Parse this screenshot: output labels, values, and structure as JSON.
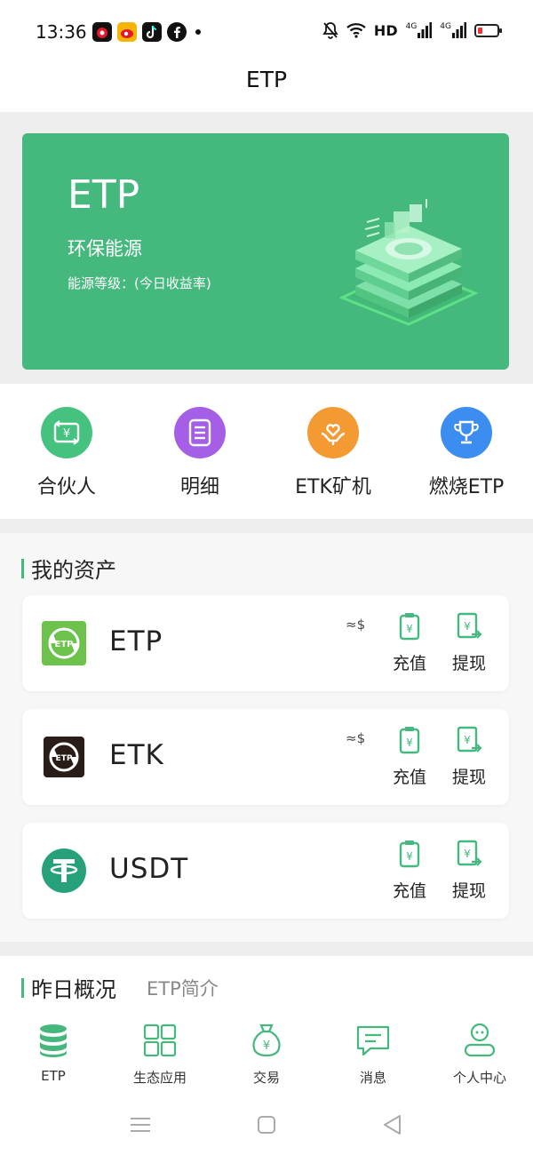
{
  "status_bar": {
    "time": "13:36",
    "network_label": "HD",
    "signal_1": "4G",
    "signal_2": "4G"
  },
  "header": {
    "title": "ETP"
  },
  "banner": {
    "title": "ETP",
    "subtitle": "环保能源",
    "description": "能源等级：(今日收益率)",
    "bg_color": "#45b87d"
  },
  "quick_menu": [
    {
      "label": "合伙人",
      "icon": "exchange-yen-icon",
      "color": "#45c37e"
    },
    {
      "label": "明细",
      "icon": "document-list-icon",
      "color": "#a55ee6"
    },
    {
      "label": "ETK矿机",
      "icon": "heart-hands-icon",
      "color": "#f39a33"
    },
    {
      "label": "燃烧ETP",
      "icon": "trophy-icon",
      "color": "#3b8ef0"
    }
  ],
  "assets": {
    "section_title": "我的资产",
    "items": [
      {
        "name": "ETP",
        "approx": "≈$",
        "deposit": "充值",
        "withdraw": "提现"
      },
      {
        "name": "ETK",
        "approx": "≈$",
        "deposit": "充值",
        "withdraw": "提现"
      },
      {
        "name": "USDT",
        "approx": "",
        "deposit": "充值",
        "withdraw": "提现"
      }
    ]
  },
  "overview": {
    "title": "昨日概况",
    "link": "ETP简介"
  },
  "tabbar": [
    {
      "label": "ETP",
      "icon": "database-icon",
      "active": true
    },
    {
      "label": "生态应用",
      "icon": "grid-apps-icon"
    },
    {
      "label": "交易",
      "icon": "money-bag-icon"
    },
    {
      "label": "消息",
      "icon": "message-icon"
    },
    {
      "label": "个人中心",
      "icon": "user-icon"
    }
  ],
  "accent_color": "#45b87d"
}
